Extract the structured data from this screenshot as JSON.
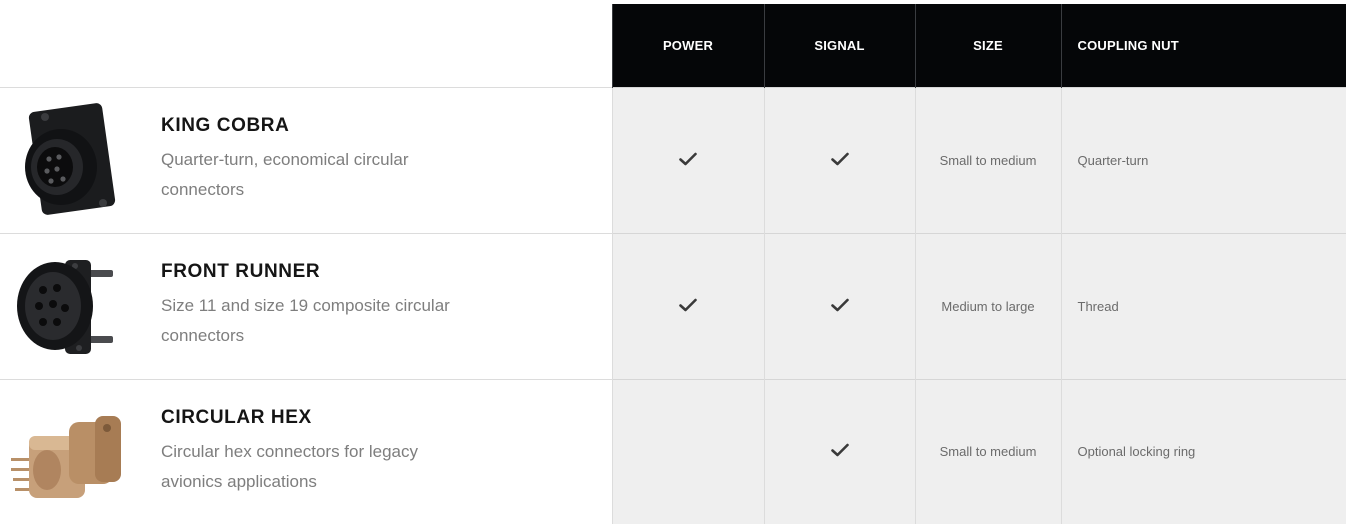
{
  "table": {
    "headers": {
      "power": "POWER",
      "signal": "SIGNAL",
      "size": "SIZE",
      "coupling_nut": "COUPLING NUT"
    },
    "rows": [
      {
        "name": "KING COBRA",
        "description": "Quarter-turn, economical circular connectors",
        "image_icon": "black-square-flange-connector-icon",
        "power": true,
        "signal": true,
        "size": "Small to medium",
        "coupling_nut": "Quarter-turn"
      },
      {
        "name": "FRONT RUNNER",
        "description": "Size 11 and size 19 composite circular connectors",
        "image_icon": "black-round-pcb-connector-icon",
        "power": true,
        "signal": true,
        "size": "Medium to large",
        "coupling_nut": "Thread"
      },
      {
        "name": "CIRCULAR HEX",
        "description": "Circular hex connectors for legacy avionics applications",
        "image_icon": "brass-hex-connector-icon",
        "power": false,
        "signal": true,
        "size": "Small to medium",
        "coupling_nut": "Optional locking ring"
      }
    ]
  },
  "colors": {
    "header_bg": "#050608",
    "cell_bg": "#efefef",
    "check": "#3a3a3a",
    "brass": "#c7a07a"
  }
}
